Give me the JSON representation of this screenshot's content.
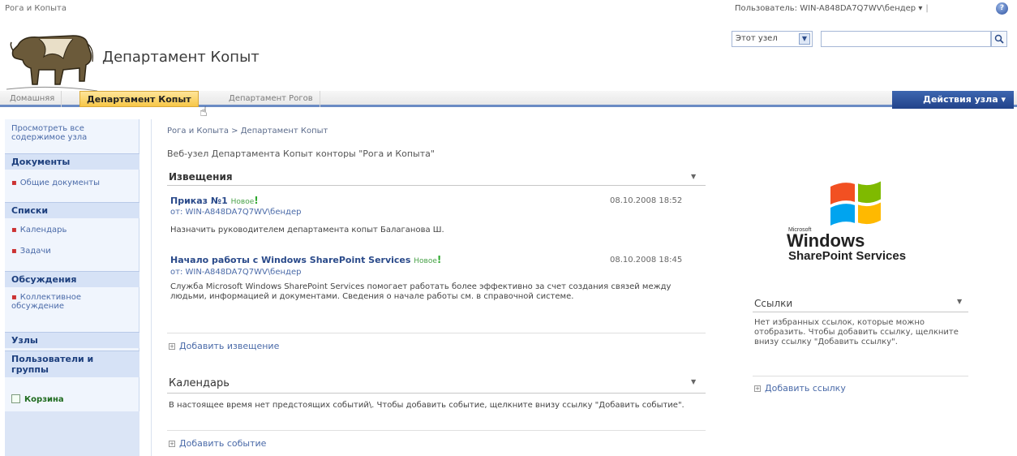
{
  "topbar": {
    "site_crumb": "Рога и Копыта",
    "user_label": "Пользователь: WIN-A848DA7Q7WV\\бендер ▾",
    "separator": "|",
    "help_icon": "help-icon"
  },
  "header": {
    "title": "Департамент Копыт",
    "scope_value": "Этот узел",
    "search_placeholder": "",
    "search_icon": "search-icon",
    "logo_icon": "cow-logo"
  },
  "tabs": [
    {
      "label": "Домашняя"
    },
    {
      "label": "Департамент Копыт"
    },
    {
      "label": "Департамент Рогов"
    }
  ],
  "site_actions_label": "Действия узла ▾",
  "leftnav": {
    "view_all": "Просмотреть все содержимое узла",
    "documents_head": "Документы",
    "shared_docs": "Общие документы",
    "lists_head": "Списки",
    "calendar": "Календарь",
    "tasks": "Задачи",
    "discussions_head": "Обсуждения",
    "team_discussion": "Коллективное обсуждение",
    "sites_head": "Узлы",
    "people_head": "Пользователи и группы",
    "recycle_bin": "Корзина"
  },
  "main": {
    "breadcrumb": "Рога и Копыта > Департамент Копыт",
    "description": "Веб-узел Департамента Копыт конторы \"Рога и Копыта\"",
    "announcements": {
      "title": "Извещения",
      "items": [
        {
          "title": "Приказ №1",
          "new_label": "Новое",
          "date": "08.10.2008 18:52",
          "from": "от: WIN-A848DA7Q7WV\\бендер",
          "body": "Назначить руководителем департамента копыт Балаганова Ш."
        },
        {
          "title": "Начало работы с Windows SharePoint Services",
          "new_label": "Новое",
          "date": "08.10.2008 18:45",
          "from": "от: WIN-A848DA7Q7WV\\бендер",
          "body": "Служба Microsoft Windows SharePoint Services помогает работать более эффективно за счет создания связей между людьми, информацией и документами. Сведения о начале работы см. в справочной системе."
        }
      ],
      "add_label": "Добавить извещение"
    },
    "calendar": {
      "title": "Календарь",
      "empty_text": "В настоящее время нет предстоящих событий\\. Чтобы добавить событие, щелкните внизу ссылку \"Добавить событие\".",
      "add_label": "Добавить событие"
    }
  },
  "right": {
    "logo": {
      "microsoft": "Microsoft",
      "windows": "Windows",
      "product": "SharePoint Services"
    },
    "links": {
      "title": "Ссылки",
      "empty_text": "Нет избранных ссылок, которые можно отобразить. Чтобы добавить ссылку, щелкните внизу ссылку \"Добавить ссылку\".",
      "add_label": "Добавить ссылку"
    }
  },
  "colors": {
    "accent": "#6a8bc4",
    "active_tab": "#f7c748",
    "nav_bg": "#f0f5fd",
    "link": "#4a6aa8"
  }
}
